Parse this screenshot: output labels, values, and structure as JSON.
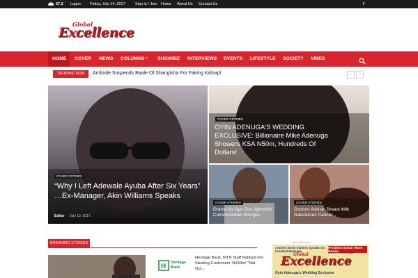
{
  "topbar": {
    "temp": "27.2",
    "deg": "°",
    "city": "Lagos",
    "date": "Friday, July 14, 2017",
    "signin": "Sign in / Join",
    "links": [
      "Home",
      "About Us",
      "Contact Us"
    ],
    "social": "f"
  },
  "logo": {
    "global": "Global",
    "exc": "Excellence"
  },
  "nav": {
    "items": [
      "HOME",
      "COVER",
      "NEWS",
      "COLUMNS",
      "SHOWBIZ",
      "INTERVIEWS",
      "EVENTS",
      "LIFESTYLE",
      "SOCIETY",
      "VIBES"
    ],
    "dropdown_arrow": "⌄",
    "search_icon": "search-icon"
  },
  "trending": {
    "label": "TRENDING NOW",
    "headline": "Ambode Suspends Baale Of Shangisha For Faking Kidnap!",
    "prev": "‹",
    "next": "›"
  },
  "tiles": [
    {
      "tag": "COVER STORIES",
      "title": "“Why I Left Adewale Ayuba After Six Years” …Ex-Manager, Akin Williams Speaks",
      "author": "Editor",
      "date": "July 13, 2017"
    },
    {
      "tag": "COVER STORIES",
      "title": "OYIN ADENUGA'S WEDDING EXCLUSIVE: Billionaire Mike Adenuga Showers KSA N50m, Hundreds Of Dollars!"
    },
    {
      "tag": "COVER STORIES",
      "title": "Drama As Oyo Gov. Ajimobi's Commissioner Resigns"
    },
    {
      "tag": "COVER STORIES",
      "title": "Doctors Advise: Breast Milk Naturalizes Cancer..."
    }
  ],
  "breaking": {
    "label": "BREAKING STORIES",
    "news_title": "Heritage Bank, MTN Staff Nabbed For Stealing Customers' N150m! \"Not Our...",
    "bank_logo_text": "Heritage Bank"
  },
  "ad": {
    "label": "- Advertisement -",
    "line1": "Actress Doris Simeon Speaks On Crashed Marriage",
    "line2": "President Buhari Won't Resign",
    "line3": "Northern Govs Angle",
    "global": "Global",
    "exc": "Excellence",
    "line4": "Oyin Adenuga's Wedding Exclusive"
  },
  "colors": {
    "accent": "#d9262c",
    "topbar": "#1c1c1c"
  }
}
